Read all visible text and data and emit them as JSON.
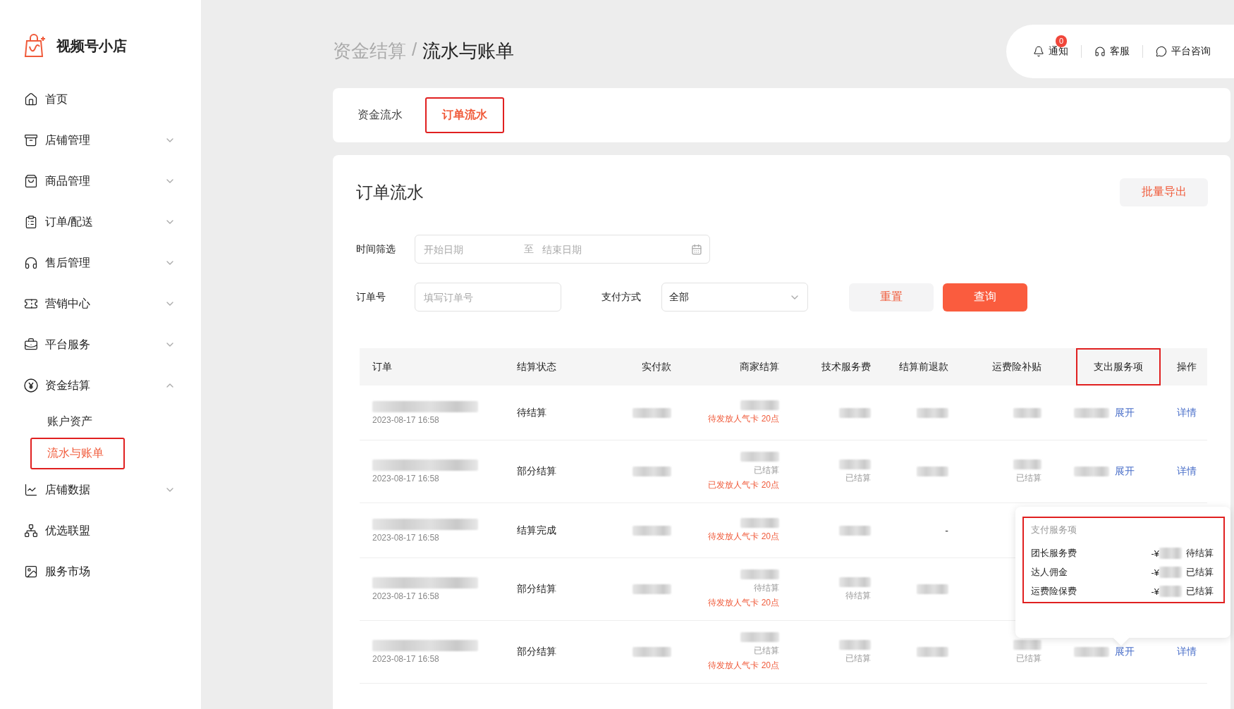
{
  "brand": {
    "name": "视频号小店"
  },
  "sidebar": {
    "items": [
      {
        "label": "首页"
      },
      {
        "label": "店铺管理",
        "expanded": false
      },
      {
        "label": "商品管理",
        "expanded": false
      },
      {
        "label": "订单/配送",
        "expanded": false
      },
      {
        "label": "售后管理",
        "expanded": false
      },
      {
        "label": "营销中心",
        "expanded": false
      },
      {
        "label": "平台服务",
        "expanded": false
      },
      {
        "label": "资金结算",
        "expanded": true,
        "children": [
          {
            "label": "账户资产",
            "selected": false
          },
          {
            "label": "流水与账单",
            "selected": true
          }
        ]
      },
      {
        "label": "店铺数据",
        "expanded": false
      },
      {
        "label": "优选联盟"
      },
      {
        "label": "服务市场"
      }
    ]
  },
  "breadcrumb": {
    "parent": "资金结算",
    "separator": "/",
    "current": "流水与账单"
  },
  "header_actions": [
    {
      "label": "通知",
      "badge": "0"
    },
    {
      "label": "客服"
    },
    {
      "label": "平台咨询"
    }
  ],
  "tabs": [
    {
      "label": "资金流水",
      "selected": false
    },
    {
      "label": "订单流水",
      "selected": true
    }
  ],
  "panel": {
    "title": "订单流水",
    "export_button": "批量导出",
    "filters": {
      "time_label": "时间筛选",
      "start_placeholder": "开始日期",
      "range_separator": "至",
      "end_placeholder": "结束日期",
      "order_label": "订单号",
      "order_placeholder": "填写订单号",
      "payment_label": "支付方式",
      "payment_value": "全部",
      "reset_button": "重置",
      "query_button": "查询"
    }
  },
  "table": {
    "columns": [
      {
        "label": "订单",
        "highlighted": false
      },
      {
        "label": "结算状态",
        "highlighted": false
      },
      {
        "label": "实付款",
        "highlighted": false
      },
      {
        "label": "商家结算",
        "highlighted": false
      },
      {
        "label": "技术服务费",
        "highlighted": false
      },
      {
        "label": "结算前退款",
        "highlighted": false
      },
      {
        "label": "运费险补贴",
        "highlighted": false
      },
      {
        "label": "支出服务项",
        "highlighted": true
      },
      {
        "label": "操作",
        "highlighted": false
      }
    ],
    "rows": [
      {
        "time": "2023-08-17 16:58",
        "status": "待结算",
        "merchant_note": "待发放人气卡 20点",
        "shipping": true,
        "expand": "展开",
        "action": "详情"
      },
      {
        "time": "2023-08-17 16:58",
        "status": "部分结算",
        "merchant_state": "已结算",
        "merchant_note": "已发放人气卡 20点",
        "tech_state": "已结算",
        "shipping": true,
        "shipping_state": "已结算",
        "expand": "展开",
        "action": "详情"
      },
      {
        "time": "2023-08-17 16:58",
        "status": "结算完成",
        "merchant_note": "待发放人气卡 20点",
        "refund_text": "-",
        "shipping": false
      },
      {
        "time": "2023-08-17 16:58",
        "status": "部分结算",
        "merchant_state": "待结算",
        "merchant_note": "待发放人气卡 20点",
        "tech_state": "待结算",
        "shipping": false
      },
      {
        "time": "2023-08-17 16:58",
        "status": "部分结算",
        "merchant_state": "已结算",
        "merchant_note": "待发放人气卡 20点",
        "tech_state": "已结算",
        "shipping": true,
        "shipping_state": "已结算",
        "expand": "展开",
        "action": "详情"
      }
    ]
  },
  "popover": {
    "title": "支付服务项",
    "highlighted": true,
    "items": [
      {
        "label": "团长服务费",
        "amount_prefix": "-¥",
        "state": "待结算"
      },
      {
        "label": "达人佣金",
        "amount_prefix": "-¥",
        "state": "已结算"
      },
      {
        "label": "运费险保费",
        "amount_prefix": "-¥",
        "state": "已结算"
      }
    ]
  }
}
